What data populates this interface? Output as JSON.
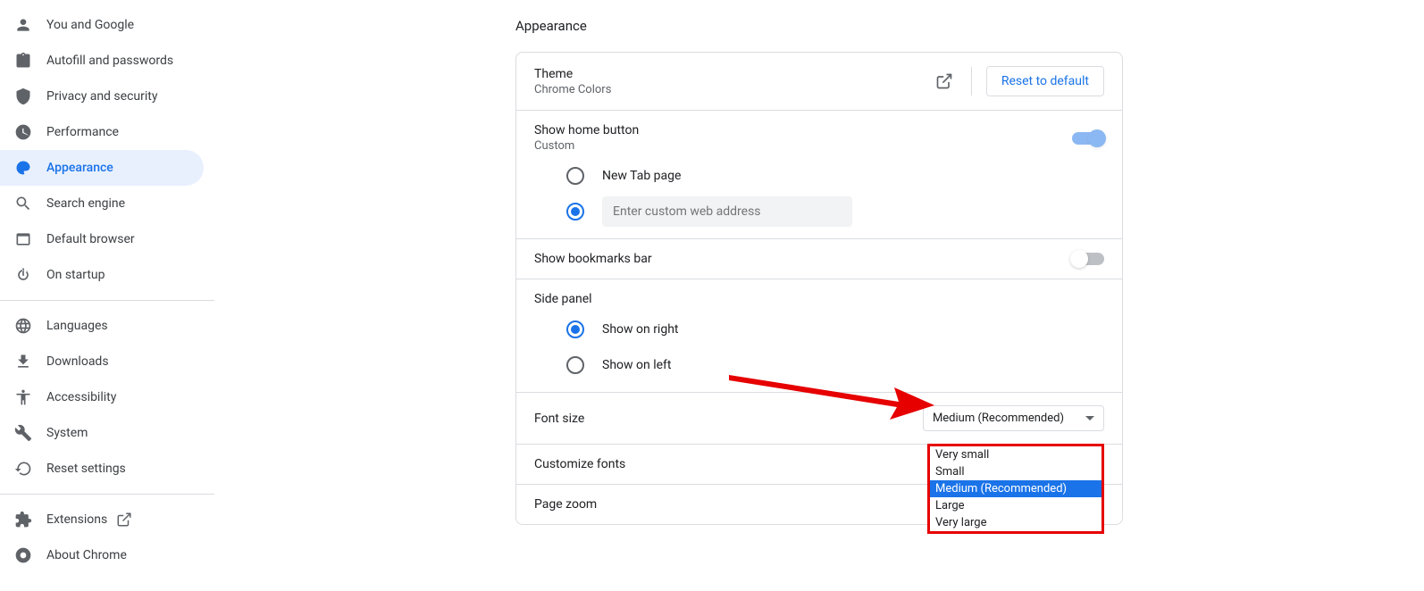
{
  "sidebar": {
    "items": [
      {
        "label": "You and Google"
      },
      {
        "label": "Autofill and passwords"
      },
      {
        "label": "Privacy and security"
      },
      {
        "label": "Performance"
      },
      {
        "label": "Appearance"
      },
      {
        "label": "Search engine"
      },
      {
        "label": "Default browser"
      },
      {
        "label": "On startup"
      }
    ],
    "items2": [
      {
        "label": "Languages"
      },
      {
        "label": "Downloads"
      },
      {
        "label": "Accessibility"
      },
      {
        "label": "System"
      },
      {
        "label": "Reset settings"
      }
    ],
    "items3": [
      {
        "label": "Extensions"
      },
      {
        "label": "About Chrome"
      }
    ]
  },
  "page": {
    "title": "Appearance"
  },
  "theme": {
    "title": "Theme",
    "subtitle": "Chrome Colors",
    "reset": "Reset to default"
  },
  "home": {
    "title": "Show home button",
    "subtitle": "Custom",
    "opt1": "New Tab page",
    "placeholder": "Enter custom web address"
  },
  "bookmarks": {
    "title": "Show bookmarks bar"
  },
  "sidepanel": {
    "title": "Side panel",
    "opt1": "Show on right",
    "opt2": "Show on left"
  },
  "fontsize": {
    "title": "Font size",
    "value": "Medium (Recommended)",
    "options": [
      "Very small",
      "Small",
      "Medium (Recommended)",
      "Large",
      "Very large"
    ]
  },
  "customfonts": {
    "title": "Customize fonts"
  },
  "pagezoom": {
    "title": "Page zoom"
  }
}
